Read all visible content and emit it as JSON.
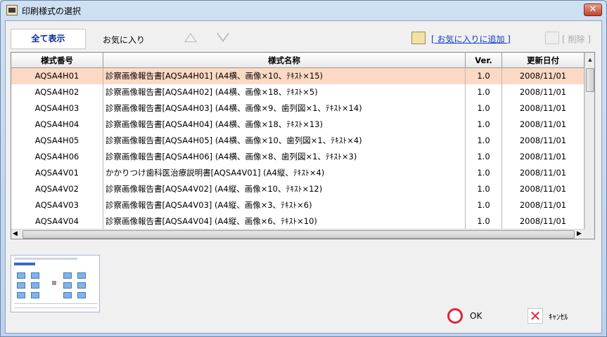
{
  "window": {
    "title": "印刷様式の選択",
    "close_label": "✕"
  },
  "toolbar": {
    "tab_all": "全て表示",
    "tab_fav": "お気に入り",
    "add_fav": "[ お気に入りに追加 ]",
    "delete": "[ 削除 ]"
  },
  "table": {
    "columns": [
      "様式番号",
      "様式名称",
      "Ver.",
      "更新日付"
    ],
    "rows": [
      [
        "AQSA4H01",
        "診察画像報告書[AQSA4H01] (A4横、画像×10、ﾃｷｽﾄ×15)",
        "1.0",
        "2008/11/01"
      ],
      [
        "AQSA4H02",
        "診察画像報告書[AQSA4H02] (A4横、画像×18、ﾃｷｽﾄ×5)",
        "1.0",
        "2008/11/01"
      ],
      [
        "AQSA4H03",
        "診察画像報告書[AQSA4H03] (A4横、画像×9、歯列図×1、ﾃｷｽﾄ×14)",
        "1.0",
        "2008/11/01"
      ],
      [
        "AQSA4H04",
        "診察画像報告書[AQSA4H04] (A4横、画像×18、ﾃｷｽﾄ×13)",
        "1.0",
        "2008/11/01"
      ],
      [
        "AQSA4H05",
        "診察画像報告書[AQSA4H05] (A4横、画像×10、歯列図×1、ﾃｷｽﾄ×4)",
        "1.0",
        "2008/11/01"
      ],
      [
        "AQSA4H06",
        "診察画像報告書[AQSA4H06] (A4横、画像×8、歯列図×1、ﾃｷｽﾄ×3)",
        "1.0",
        "2008/11/01"
      ],
      [
        "AQSA4V01",
        "かかりつけ歯科医治療説明書[AQSA4V01] (A4縦、ﾃｷｽﾄ×4)",
        "1.0",
        "2008/11/01"
      ],
      [
        "AQSA4V02",
        "診察画像報告書[AQSA4V02] (A4縦、画像×10、ﾃｷｽﾄ×12)",
        "1.0",
        "2008/11/01"
      ],
      [
        "AQSA4V03",
        "診察画像報告書[AQSA4V03] (A4縦、画像×3、ﾃｷｽﾄ×6)",
        "1.0",
        "2008/11/01"
      ],
      [
        "AQSA4V04",
        "診察画像報告書[AQSA4V04] (A4縦、画像×6、ﾃｷｽﾄ×10)",
        "1.0",
        "2008/11/01"
      ]
    ]
  },
  "buttons": {
    "ok": "OK",
    "cancel": "ｷｬﾝｾﾙ"
  }
}
